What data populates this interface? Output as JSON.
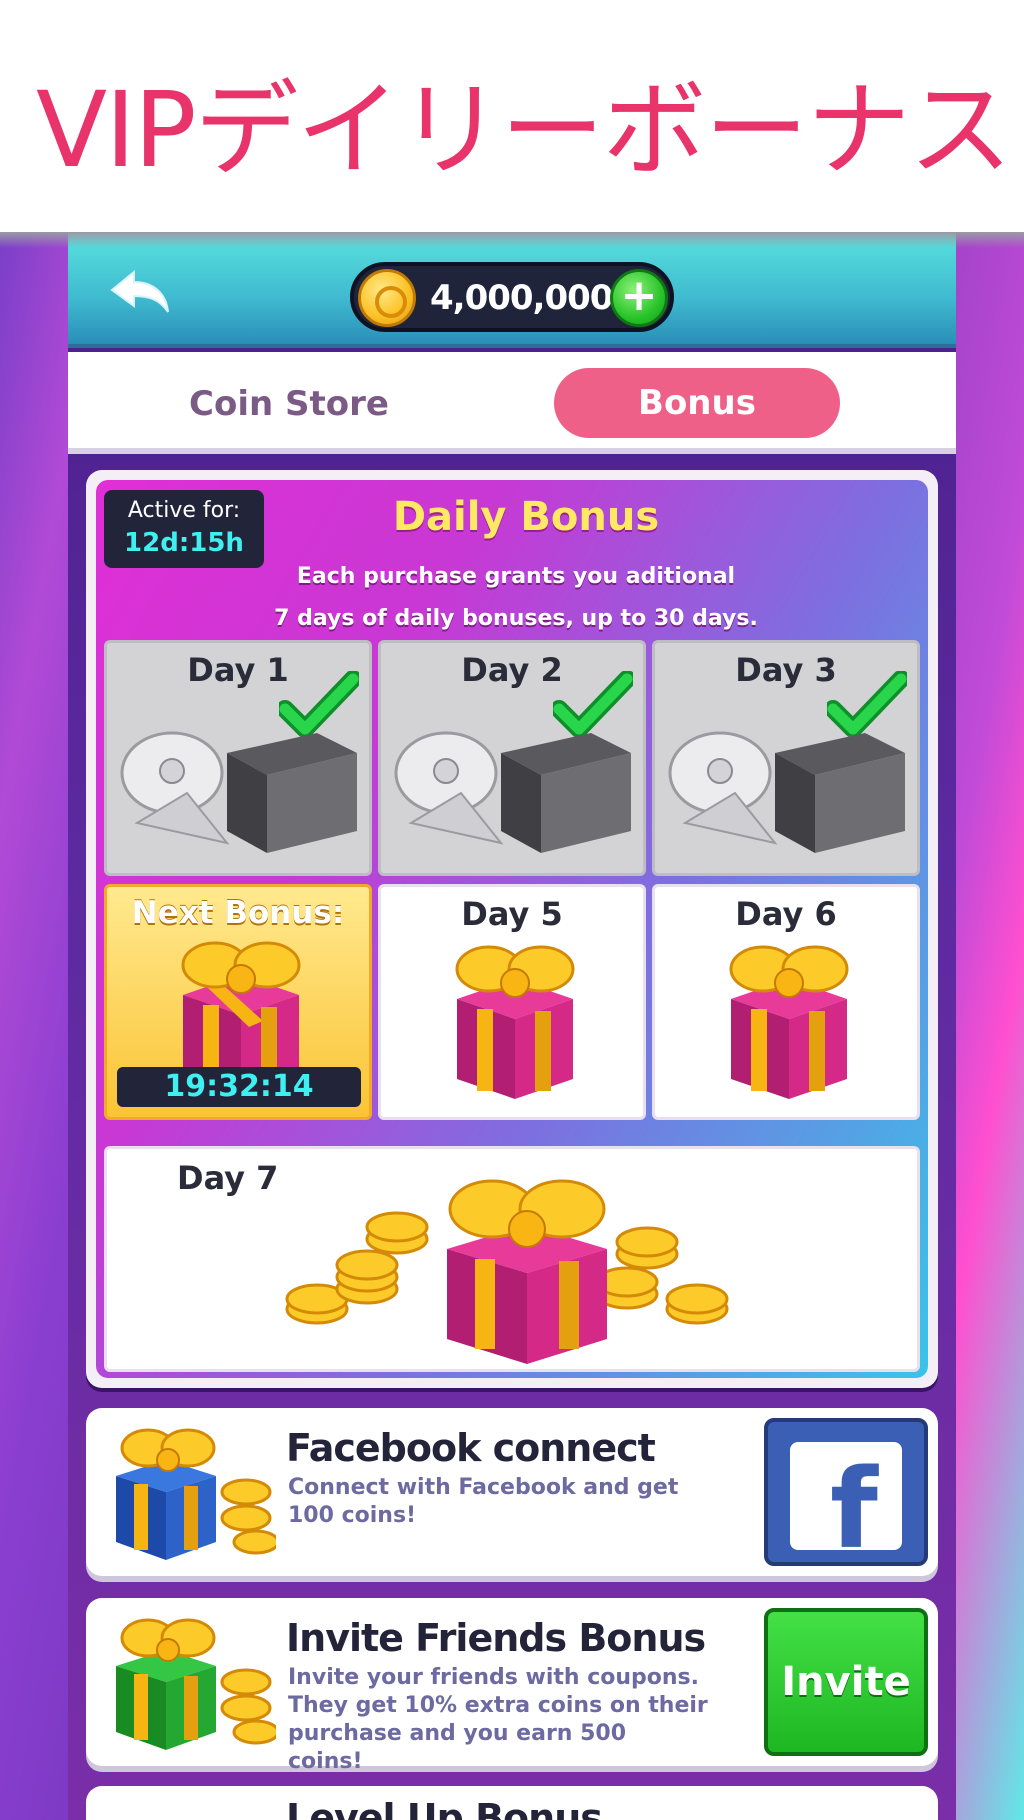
{
  "banner": {
    "title": "VIPデイリーボーナス"
  },
  "header": {
    "coins": "4,000,000",
    "icons": {
      "back": "back-arrow-icon",
      "coin": "coin-icon",
      "add": "plus-icon"
    }
  },
  "tabs": [
    {
      "label": "Coin Store",
      "active": false
    },
    {
      "label": "Bonus",
      "active": true
    }
  ],
  "daily": {
    "active_label": "Active for:",
    "active_value": "12d:15h",
    "title": "Daily Bonus",
    "subtitle_line1": "Each purchase grants you aditional",
    "subtitle_line2": "7 days of daily bonuses, up to 30 days.",
    "days": [
      {
        "label": "Day 1",
        "state": "claimed"
      },
      {
        "label": "Day 2",
        "state": "claimed"
      },
      {
        "label": "Day 3",
        "state": "claimed"
      },
      {
        "label": "Next Bonus:",
        "state": "next",
        "timer": "19:32:14"
      },
      {
        "label": "Day 5",
        "state": "locked"
      },
      {
        "label": "Day 6",
        "state": "locked"
      },
      {
        "label": "Day 7",
        "state": "locked"
      }
    ]
  },
  "promos": [
    {
      "title": "Facebook connect",
      "desc": "Connect with Facebook and get 100 coins!",
      "button": "facebook-icon"
    },
    {
      "title": "Invite Friends Bonus",
      "desc": "Invite your friends with coupons. They get 10% extra coins on their purchase and you earn 500 coins!",
      "button_label": "Invite"
    },
    {
      "title": "Level Up Bonus"
    }
  ],
  "colors": {
    "accent_pink": "#e8336b",
    "tab_active": "#ef6088",
    "timer_cyan": "#3ff0f0",
    "title_yellow": "#ffe964",
    "facebook_blue": "#3b5fb5",
    "invite_green": "#1db722"
  }
}
